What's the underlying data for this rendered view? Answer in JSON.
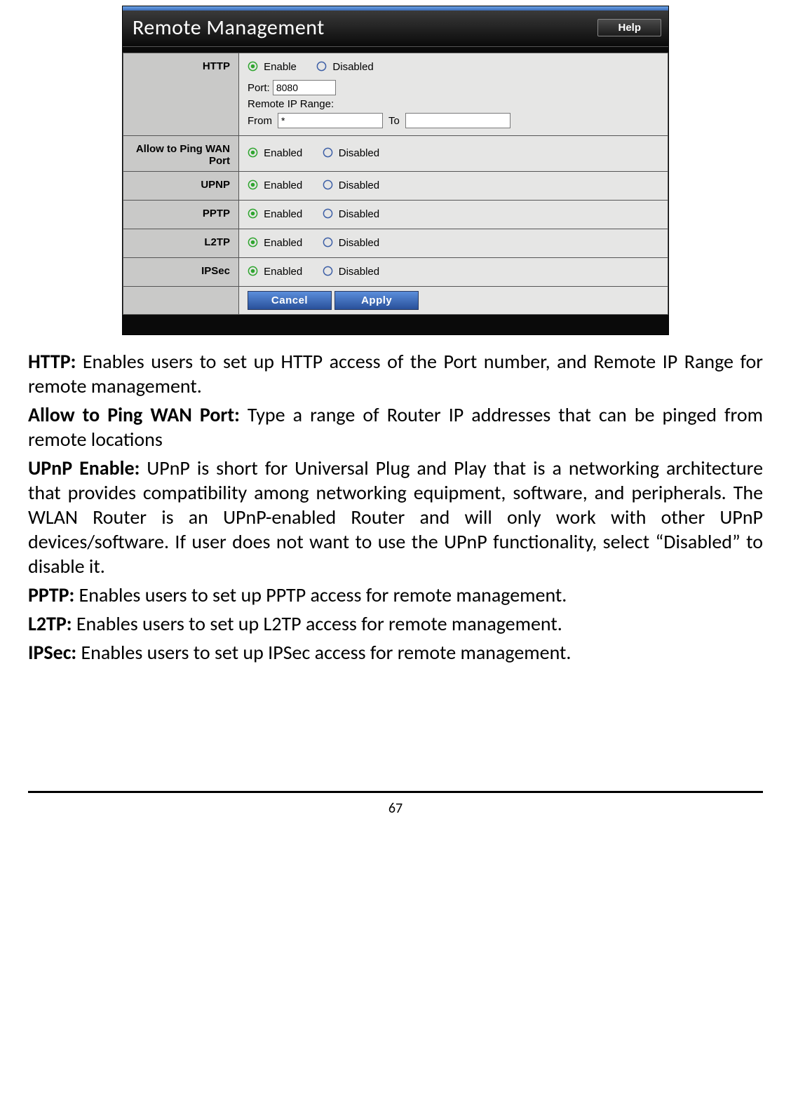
{
  "panel": {
    "title": "Remote Management",
    "help_label": "Help",
    "sections": {
      "http": {
        "label": "HTTP",
        "enable_label": "Enable",
        "disabled_label": "Disabled",
        "port_label": "Port:",
        "port_value": "8080",
        "range_label": "Remote IP Range:",
        "from_label": "From",
        "from_value": "*",
        "to_label": "To",
        "to_value": ""
      },
      "pingwan": {
        "label": "Allow to Ping WAN Port",
        "enabled_label": "Enabled",
        "disabled_label": "Disabled"
      },
      "upnp": {
        "label": "UPNP",
        "enabled_label": "Enabled",
        "disabled_label": "Disabled"
      },
      "pptp": {
        "label": "PPTP",
        "enabled_label": "Enabled",
        "disabled_label": "Disabled"
      },
      "l2tp": {
        "label": "L2TP",
        "enabled_label": "Enabled",
        "disabled_label": "Disabled"
      },
      "ipsec": {
        "label": "IPSec",
        "enabled_label": "Enabled",
        "disabled_label": "Disabled"
      }
    },
    "buttons": {
      "cancel": "Cancel",
      "apply": "Apply"
    }
  },
  "descriptions": {
    "http": {
      "label": "HTTP:",
      "text": " Enables users to set up HTTP access of the Port number, and Remote IP Range for remote management."
    },
    "pingwan": {
      "label": "Allow to Ping WAN Port:",
      "text": " Type a range of Router IP addresses that can be pinged from remote locations"
    },
    "upnp": {
      "label": "UPnP Enable:",
      "text": " UPnP is short for Universal Plug and Play that is a networking architecture that provides compatibility among networking equipment, software, and peripherals. The WLAN Router is an UPnP-enabled Router and will only work with other UPnP devices/software. If user does not want to use the UPnP functionality, select “Disabled” to disable it."
    },
    "pptp": {
      "label": "PPTP:",
      "text": " Enables users to set up PPTP access for remote management."
    },
    "l2tp": {
      "label": "L2TP:",
      "text": " Enables users to set up L2TP access for remote management."
    },
    "ipsec": {
      "label": "IPSec:",
      "text": " Enables users to set up IPSec access for remote management."
    }
  },
  "page_number": "67"
}
